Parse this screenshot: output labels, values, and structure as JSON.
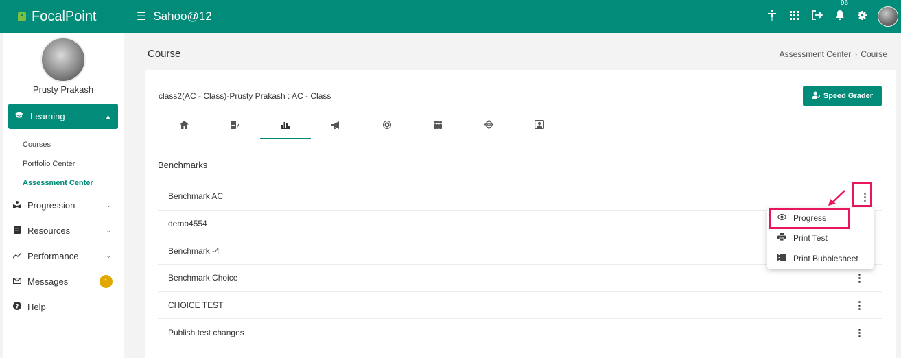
{
  "header": {
    "brand": "FocalPoint",
    "username": "Sahoo@12",
    "notification_count": "96",
    "icons": [
      "accessibility-icon",
      "apps-grid-icon",
      "logout-icon",
      "bell-icon",
      "gear-icon"
    ],
    "accent_color": "#008c79"
  },
  "sidebar": {
    "user_name": "Prusty Prakash",
    "learning": {
      "label": "Learning",
      "icon": "graduation-cap-icon"
    },
    "learning_subitems": [
      {
        "label": "Courses",
        "active": false
      },
      {
        "label": "Portfolio Center",
        "active": false
      },
      {
        "label": "Assessment Center",
        "active": true
      }
    ],
    "items": [
      {
        "label": "Progression",
        "icon": "reading-icon"
      },
      {
        "label": "Resources",
        "icon": "book-icon"
      },
      {
        "label": "Performance",
        "icon": "trend-icon"
      },
      {
        "label": "Messages",
        "icon": "envelope-icon",
        "badge": "1"
      },
      {
        "label": "Help",
        "icon": "question-icon"
      }
    ]
  },
  "main": {
    "page_title": "Course",
    "breadcrumb": [
      "Assessment Center",
      "Course"
    ],
    "class_title": "class2(AC - Class)-Prusty Prakash : AC - Class",
    "speed_grader_label": "Speed Grader",
    "tabs": [
      "home-icon",
      "edit-doc-icon",
      "benchmark-chart-icon",
      "megaphone-icon",
      "target-icon",
      "people-icon",
      "settings-icon",
      "portrait-icon"
    ],
    "active_tab": 2,
    "section_title": "Benchmarks",
    "benchmarks": [
      "Benchmark AC",
      "demo4554",
      "Benchmark -4",
      "Benchmark Choice",
      "CHOICE TEST",
      "Publish test changes"
    ]
  },
  "context_menu": {
    "items": [
      {
        "label": "Progress",
        "icon": "eye-icon"
      },
      {
        "label": "Print Test",
        "icon": "printer-icon"
      },
      {
        "label": "Print Bubblesheet",
        "icon": "bubblesheet-icon"
      }
    ]
  }
}
